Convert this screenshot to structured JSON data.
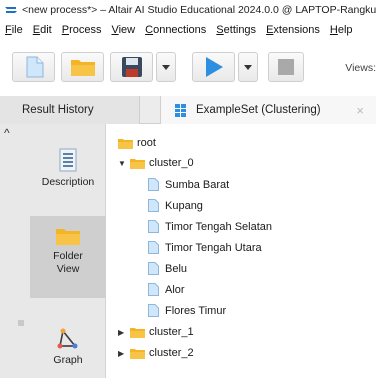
{
  "window": {
    "title": "<new process*> – Altair AI Studio Educational 2024.0.0 @ LAPTOP-Rangku"
  },
  "menubar": {
    "items": [
      {
        "mnemonic": "F",
        "rest": "ile"
      },
      {
        "mnemonic": "E",
        "rest": "dit"
      },
      {
        "mnemonic": "P",
        "rest": "rocess"
      },
      {
        "mnemonic": "V",
        "rest": "iew"
      },
      {
        "mnemonic": "C",
        "rest": "onnections"
      },
      {
        "mnemonic": "S",
        "rest": "ettings"
      },
      {
        "mnemonic": "E",
        "rest": "xtensions"
      },
      {
        "mnemonic": "H",
        "rest": "elp"
      }
    ]
  },
  "toolbar": {
    "views_label": "Views:",
    "icons": [
      "new-process-icon",
      "open-folder-icon",
      "save-icon",
      "run-icon",
      "stop-icon"
    ]
  },
  "tabs": {
    "result_history": "Result History",
    "exampleset": "ExampleSet (Clustering)",
    "close": "×"
  },
  "sidepanel": {
    "collapse": "^",
    "description": "Description",
    "folder_view_line1": "Folder",
    "folder_view_line2": "View",
    "graph": "Graph"
  },
  "tree": {
    "root": "root",
    "cluster_0": {
      "label": "cluster_0",
      "expanded": true,
      "items": [
        "Sumba Barat",
        "Kupang",
        "Timor Tengah Selatan",
        "Timor Tengah Utara",
        "Belu",
        "Alor",
        "Flores Timur"
      ]
    },
    "cluster_1": {
      "label": "cluster_1",
      "expanded": false
    },
    "cluster_2": {
      "label": "cluster_2",
      "expanded": false
    }
  },
  "colors": {
    "folder": "#f3b526",
    "document": "#cfe6fb",
    "run": "#2e8fe0",
    "selected_side": "#cfcfcf"
  }
}
